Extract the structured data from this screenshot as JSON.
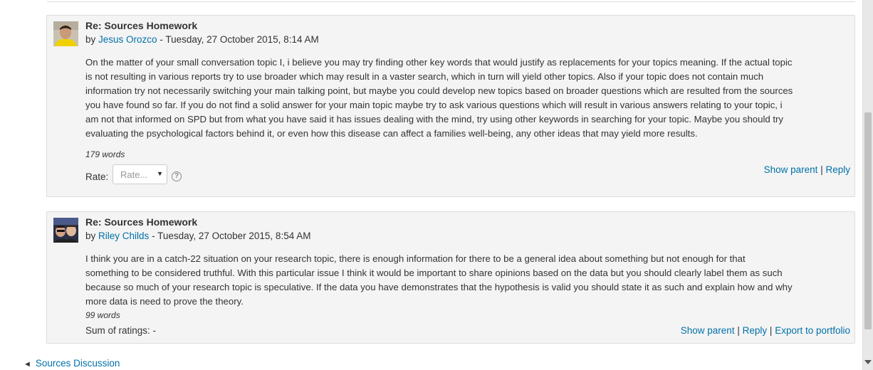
{
  "posts": [
    {
      "subject": "Re: Sources Homework",
      "by_prefix": "by",
      "author": "Jesus Orozco",
      "date": "- Tuesday, 27 October 2015, 8:14 AM",
      "lines": [
        "On the matter of your small conversation topic I, i believe you may try finding other key words that would justify as replacements for your topics meaning. If the actual topic",
        "is not resulting in various reports try to use broader which may result in a vaster search, which in turn will yield other topics. Also if your topic does not contain much",
        "information try not necessarily switching your main talking point, but maybe you could develop new topics based on broader questions which are resulted from the sources",
        "you have found so far. If you do not find a solid answer for your main topic maybe try to ask various questions which will result in various answers relating to your topic, i",
        "am not that informed on SPD but from what you have said it has issues dealing with the mind, try using other keywords in searching for your topic. Maybe you should try",
        "evaluating the psychological factors behind it, or even how this disease can affect a families well-being, any other ideas that may yield more results."
      ],
      "word_count": "179 words",
      "rate_label": "Rate:",
      "rate_select": "Rate...",
      "help_icon": "?",
      "show_parent": "Show parent",
      "reply": "Reply",
      "separator": "|"
    },
    {
      "subject": "Re: Sources Homework",
      "by_prefix": "by",
      "author": "Riley Childs",
      "date": "- Tuesday, 27 October 2015, 8:54 AM",
      "lines": [
        "I think you are in a catch-22 situation on your research topic, there is enough information for there to be a general idea about something but not enough for that",
        "something to be considered truthful. With this particular issue I think it would be important to share opinions based on the data but you should clearly label them as such",
        "because so much of your research topic is speculative. If the data you have demonstrates that the hypothesis is valid you should state it as such and explain how and why",
        "more data is need to prove the theory."
      ],
      "word_count": "99 words",
      "sum_ratings": "Sum of ratings: -",
      "show_parent": "Show parent",
      "reply": "Reply",
      "export": "Export to portfolio",
      "separator": "|"
    }
  ],
  "navigation": {
    "prev_icon": "◄",
    "prev_label": "Sources Discussion"
  },
  "colors": {
    "link": "#0070a8",
    "post_background": "#f4f4f4",
    "post_border": "#dcdcdc"
  }
}
